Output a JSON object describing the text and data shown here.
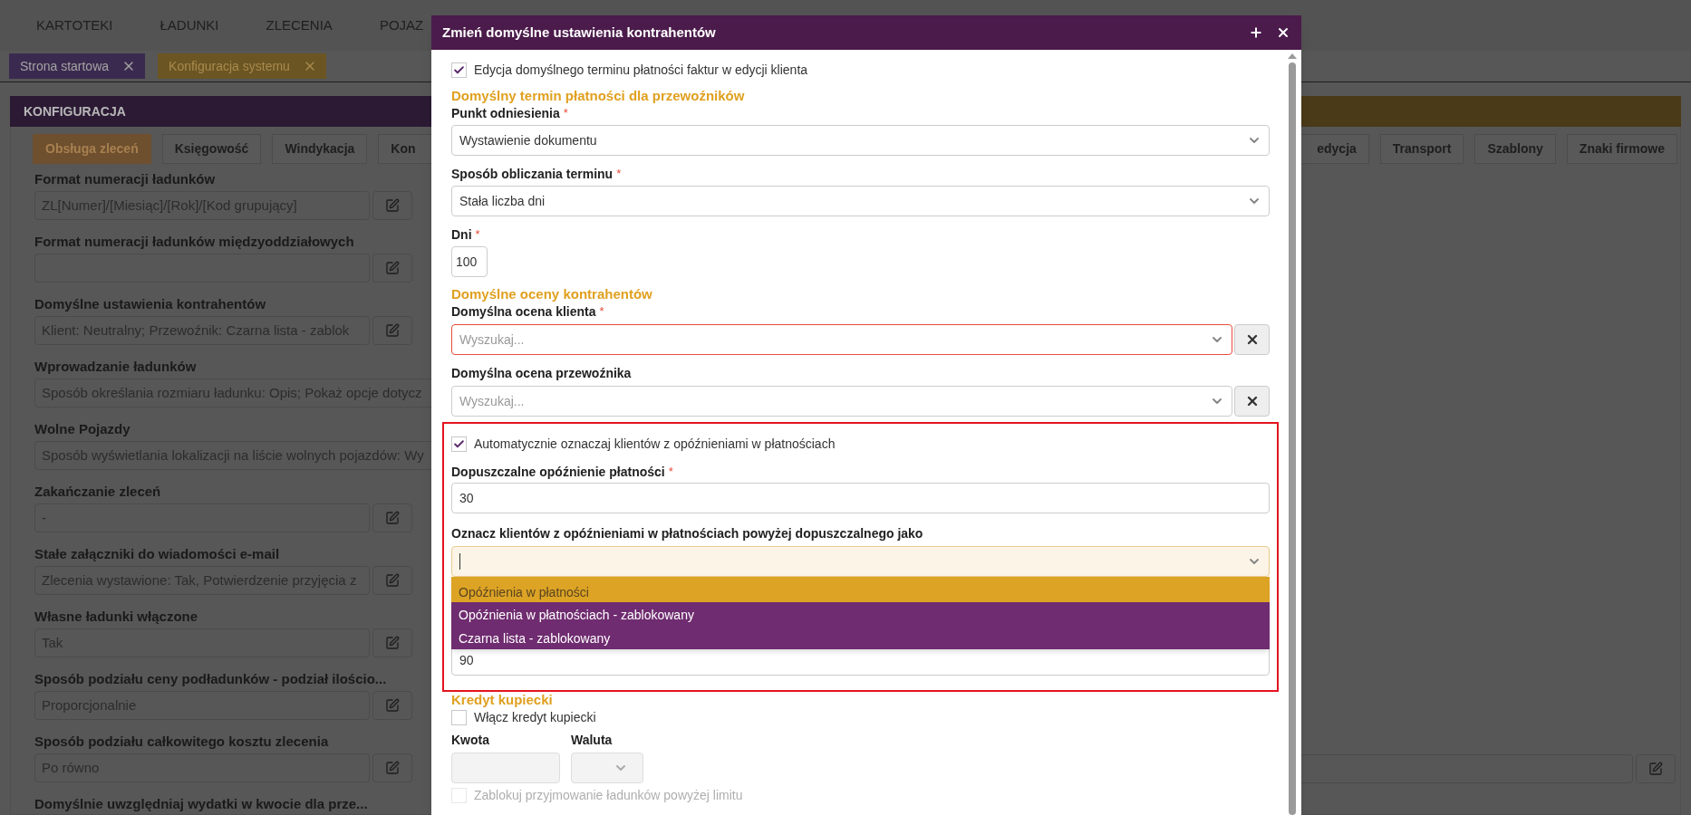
{
  "nav": {
    "items": [
      "KARTOTEKI",
      "ŁADUNKI",
      "ZLECENIA",
      "POJAZ"
    ]
  },
  "open_tabs": [
    {
      "label": "Strona startowa",
      "selected": false
    },
    {
      "label": "Konfiguracja systemu",
      "selected": true
    }
  ],
  "panel": {
    "title": "KONFIGURACJA",
    "tabs_left": [
      {
        "label": "Obsługa zleceń",
        "selected": true
      },
      {
        "label": "Księgowość",
        "selected": false
      },
      {
        "label": "Windykacja",
        "selected": false
      },
      {
        "label": "Kon",
        "selected": false
      }
    ],
    "tabs_right": [
      {
        "label": "edycja",
        "selected": false
      },
      {
        "label": "Transport",
        "selected": false
      },
      {
        "label": "Szablony",
        "selected": false
      },
      {
        "label": "Znaki firmowe",
        "selected": false
      }
    ],
    "settings": [
      {
        "kind": "editable",
        "label": "Format numeracji ładunków",
        "value": "ZL[Numer]/[Miesiąc]/[Rok]/[Kod grupujący]"
      },
      {
        "kind": "editable",
        "label": "Format numeracji ładunków międzyoddziałowych"
      },
      {
        "kind": "editable",
        "label": "Domyślne ustawienia kontrahentów",
        "value": "Klient: Neutralny; Przewoźnik: Czarna lista - zablok"
      },
      {
        "kind": "wide",
        "label": "Wprowadzanie ładunków",
        "value": "Sposób określania rozmiaru ładunku: Opis; Pokaż opcje dotycz"
      },
      {
        "kind": "wide",
        "label": "Wolne Pojazdy",
        "value": "Sposób wyświetlania lokalizacji na liście wolnych pojazdów: Wy"
      },
      {
        "kind": "editable",
        "label": "Zakańczanie zleceń",
        "value": "-"
      },
      {
        "kind": "editable",
        "label": "Stałe załączniki do wiadomości e-mail",
        "value": "Zlecenia wystawione: Tak, Potwierdzenie przyjęcia z"
      },
      {
        "kind": "editable",
        "label": "Własne ładunki włączone",
        "value": "Tak"
      },
      {
        "kind": "editable",
        "label": "Sposób podziału ceny podładunków - podział ilościo...",
        "value": "Proporcjonalnie"
      },
      {
        "kind": "editable",
        "label": "Sposób podziału całkowitego kosztu zlecenia",
        "value": "Po równo"
      },
      {
        "kind": "title",
        "label": "Domyślnie uwzględniaj wydatki w kwocie dla prze..."
      }
    ]
  },
  "dialog": {
    "title": "Zmień domyślne ustawienia kontrahentów",
    "items": [
      {
        "kind": "checkbox",
        "label": "Edycja domyślnego terminu płatności faktur w edycji klienta",
        "checked": true,
        "disabled": false
      },
      {
        "kind": "heading",
        "text": "Domyślny termin płatności dla przewoźników"
      },
      {
        "kind": "select",
        "label": "Punkt odniesienia",
        "required_mark": "*",
        "value": "Wystawienie dokumentu"
      },
      {
        "kind": "select",
        "label": "Sposób obliczania terminu",
        "required_mark": "*",
        "value": "Stała liczba dni"
      },
      {
        "kind": "number",
        "label": "Dni",
        "required_mark": "*",
        "value": "100"
      },
      {
        "kind": "heading",
        "text": "Domyślne oceny kontrahentów"
      },
      {
        "kind": "search",
        "label": "Domyślna ocena klienta",
        "required_mark": "*",
        "placeholder": "Wyszukaj...",
        "invalid": true
      },
      {
        "kind": "search",
        "label": "Domyślna ocena przewoźnika",
        "placeholder": "Wyszukaj...",
        "invalid": false
      },
      {
        "kind": "group",
        "highlighted": true,
        "children": [
          {
            "kind": "checkbox",
            "label": "Automatycznie oznaczaj klientów z opóźnieniami w płatnościach",
            "checked": true,
            "disabled": false
          },
          {
            "kind": "text",
            "label": "Dopuszczalne opóźnienie płatności",
            "required_mark": "*",
            "value": "30"
          },
          {
            "kind": "combo",
            "label": "Oznacz klientów z opóźnieniami w płatnościach powyżej dopuszczalnego jako",
            "focused": true,
            "options": [
              {
                "label": "Opóźnienia w płatności",
                "selected": true
              },
              {
                "label": "Opóźnienia w płatnościach - zablokowany",
                "selected": false
              },
              {
                "label": "Czarna lista - zablokowany",
                "selected": false
              }
            ]
          },
          {
            "kind": "text",
            "value": "90"
          }
        ]
      },
      {
        "kind": "heading",
        "text": "Kredyt kupiecki"
      },
      {
        "kind": "checkbox",
        "label": "Włącz kredyt kupiecki",
        "checked": false,
        "disabled": false
      },
      {
        "kind": "pair",
        "fields": [
          {
            "kind": "input",
            "label": "Kwota",
            "disabled": true
          },
          {
            "kind": "select",
            "label": "Waluta",
            "disabled": true
          }
        ]
      },
      {
        "kind": "checkbox",
        "label": "Zablokuj przyjmowanie ładunków powyżej limitu",
        "checked": false,
        "disabled": true
      }
    ]
  }
}
